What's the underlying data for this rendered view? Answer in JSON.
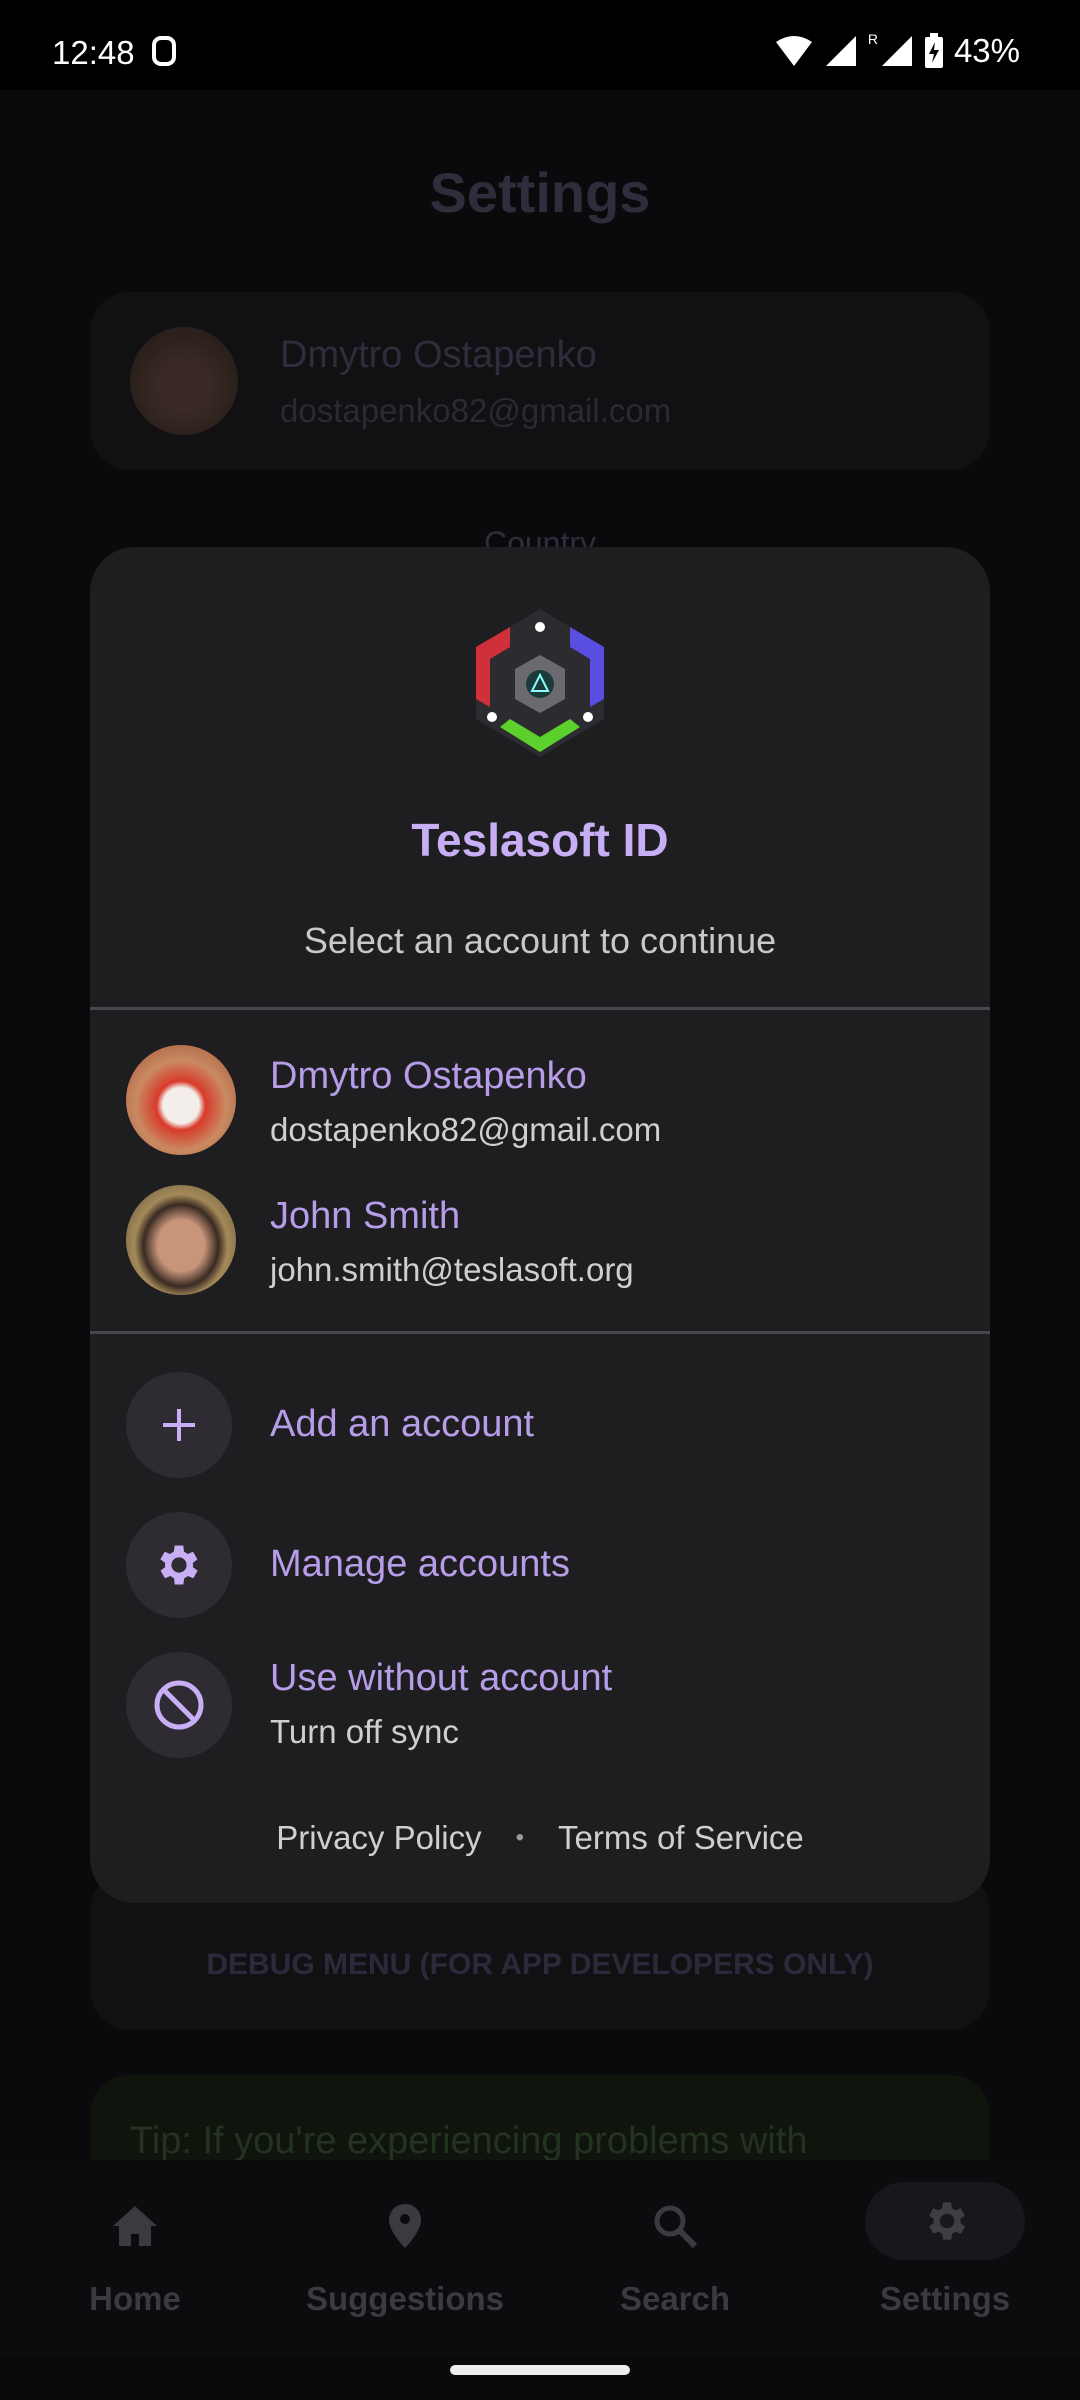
{
  "status_bar": {
    "time": "12:48",
    "battery": "43%",
    "roaming": "R"
  },
  "background": {
    "title": "Settings",
    "profile": {
      "name": "Dmytro Ostapenko",
      "email": "dostapenko82@gmail.com"
    },
    "country_label": "Country",
    "debug_button": "DEBUG MENU (FOR APP DEVELOPERS ONLY)",
    "tip": "Tip: If you're experiencing problems with"
  },
  "dialog": {
    "title": "Teslasoft ID",
    "subtitle": "Select an account to continue",
    "accounts": [
      {
        "name": "Dmytro Ostapenko",
        "email": "dostapenko82@gmail.com"
      },
      {
        "name": "John Smith",
        "email": "john.smith@teslasoft.org"
      }
    ],
    "actions": [
      {
        "label": "Add an account",
        "icon": "plus-icon"
      },
      {
        "label": "Manage accounts",
        "icon": "gear-icon"
      },
      {
        "label": "Use without account",
        "sublabel": "Turn off sync",
        "icon": "block-icon"
      }
    ],
    "footer": {
      "privacy": "Privacy Policy",
      "separator": "•",
      "terms": "Terms of Service"
    }
  },
  "nav": [
    {
      "label": "Home",
      "icon": "home-icon"
    },
    {
      "label": "Suggestions",
      "icon": "location-pin-icon"
    },
    {
      "label": "Search",
      "icon": "search-icon"
    },
    {
      "label": "Settings",
      "icon": "gear-icon",
      "selected": true
    }
  ],
  "colors": {
    "accent": "#c7aef5",
    "dialog_bg": "#1e1e21",
    "scrim_bg": "#0a0a0c"
  }
}
